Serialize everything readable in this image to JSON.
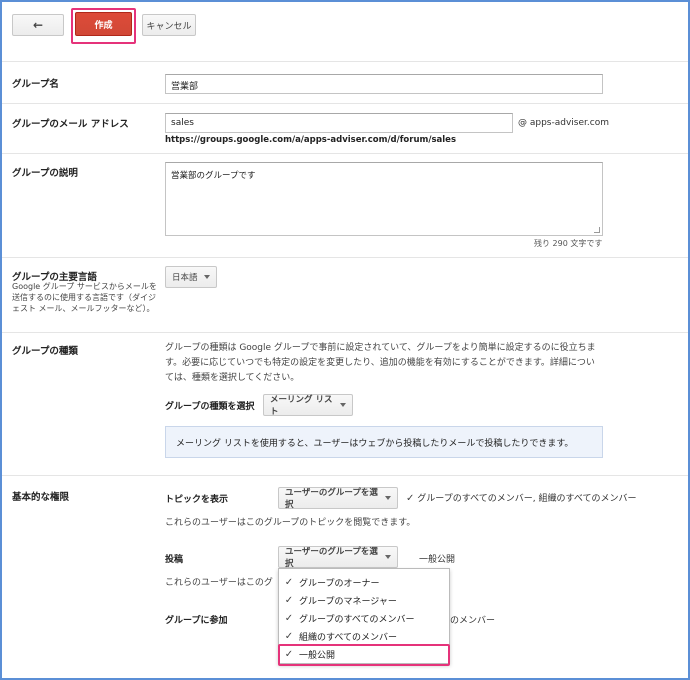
{
  "toolbar": {
    "back_icon": "←",
    "create_label": "作成",
    "cancel_label": "キャンセル"
  },
  "fields": {
    "group_name": {
      "label": "グループ名",
      "value": "営業部"
    },
    "group_email": {
      "label": "グループのメール アドレス",
      "value": "sales",
      "suffix": "@ apps-adviser.com",
      "url": "https://groups.google.com/a/apps-adviser.com/d/forum/sales"
    },
    "group_description": {
      "label": "グループの説明",
      "value": "営業部のグループです",
      "remaining": "残り 290 文字です"
    },
    "primary_language": {
      "label": "グループの主要言語",
      "help": "Google グループ サービスからメールを送信するのに使用する言語です（ダイジェスト メール、メールフッターなど）。",
      "value": "日本語"
    },
    "group_type": {
      "label": "グループの種類",
      "description": "グループの種類は Google グループで事前に設定されていて、グループをより簡単に設定するのに役立ちます。必要に応じていつでも特定の設定を変更したり、追加の機能を有効にすることができます。詳細については、種類を選択してください。",
      "select_label": "グループの種類を選択",
      "select_value": "メーリング リスト",
      "info": "メーリング リストを使用すると、ユーザーはウェブから投稿したりメールで投稿したりできます。"
    }
  },
  "permissions": {
    "label": "基本的な権限",
    "view_topics": {
      "label": "トピックを表示",
      "select_value": "ユーザーのグループを選択",
      "summary": "グループのすべてのメンバー, 組織のすべてのメンバー",
      "note": "これらのユーザーはこのグループのトピックを閲覧できます。"
    },
    "post": {
      "label": "投稿",
      "select_value": "ユーザーのグループを選択",
      "summary": "一般公開",
      "note_partial": "これらのユーザーはこのグ"
    },
    "join": {
      "label": "グループに参加",
      "summary_partial": "のメンバー"
    }
  },
  "menu": {
    "items": [
      {
        "label": "グループのオーナー",
        "checked": true
      },
      {
        "label": "グループのマネージャー",
        "checked": true
      },
      {
        "label": "グループのすべてのメンバー",
        "checked": true
      },
      {
        "label": "組織のすべてのメンバー",
        "checked": true
      },
      {
        "label": "一般公開",
        "checked": true
      }
    ],
    "check_glyph": "✓"
  },
  "colors": {
    "primary_button": "#d14836",
    "highlight": "#e5337a",
    "info_bg": "#eef3fb"
  }
}
